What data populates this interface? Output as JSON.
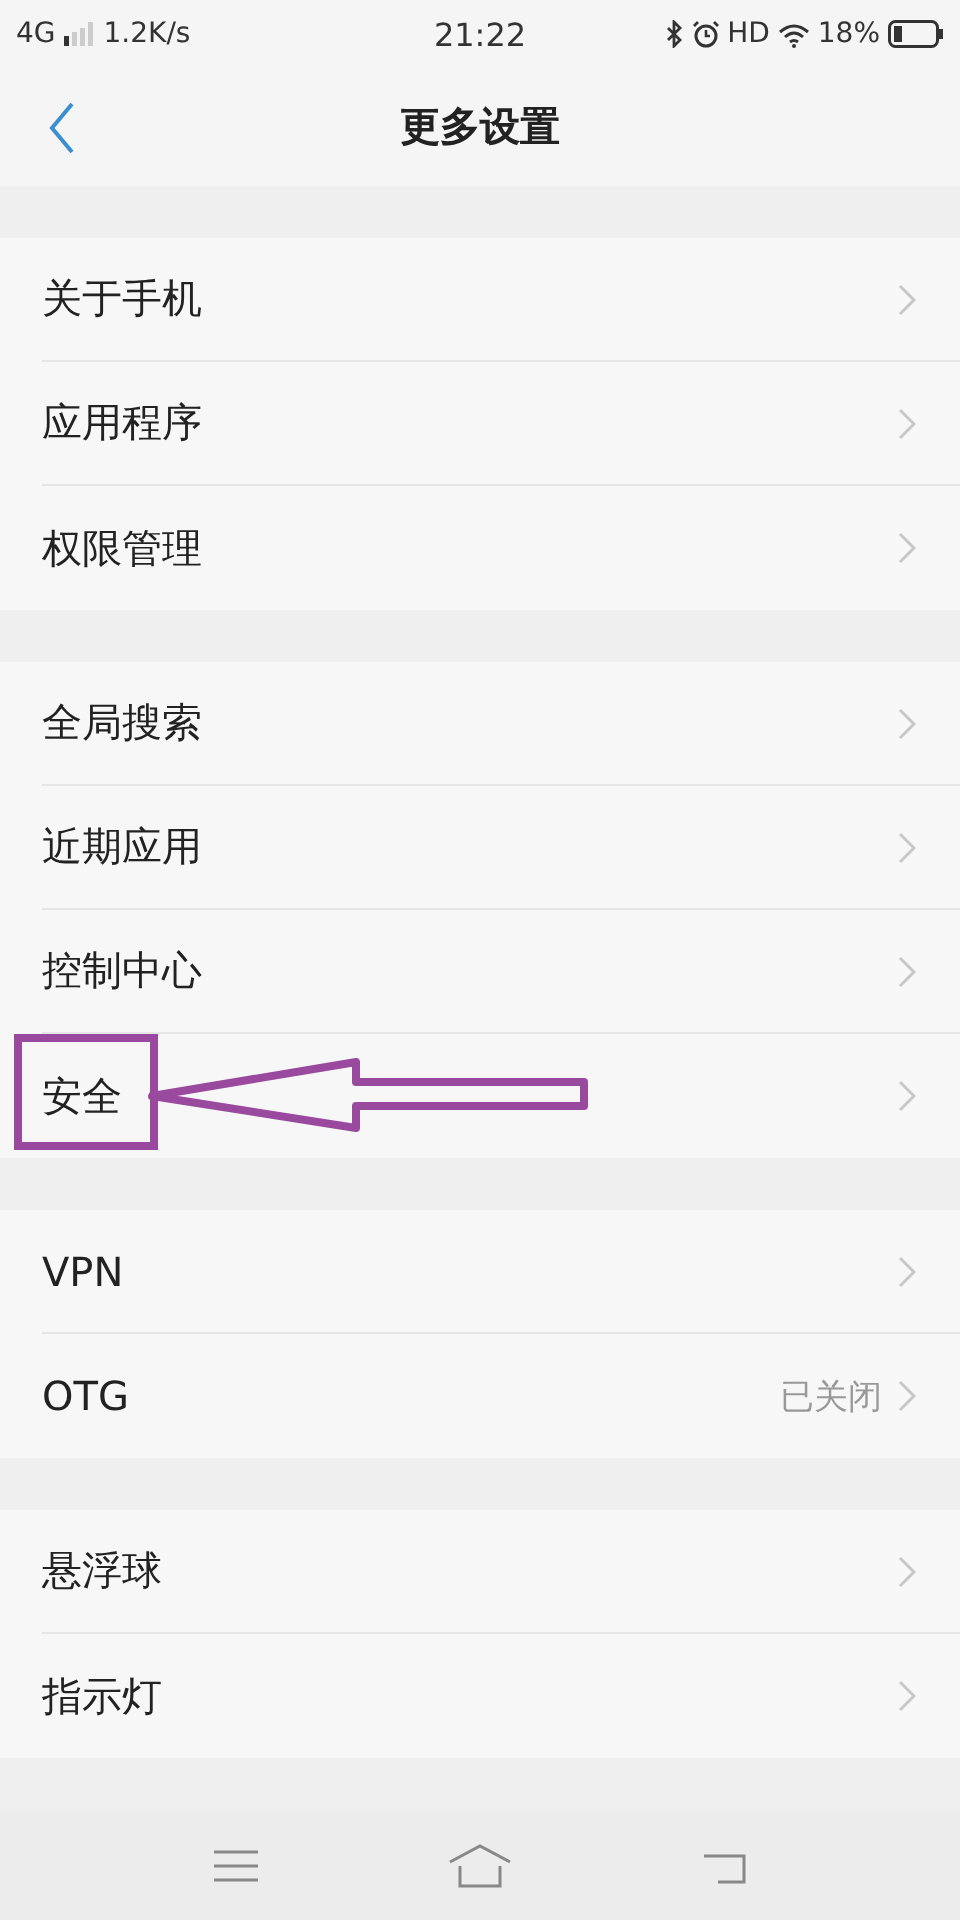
{
  "status_bar": {
    "network": "4G",
    "speed": "1.2K/s",
    "time": "21:22",
    "hd": "HD",
    "battery": "18%"
  },
  "header": {
    "title": "更多设置"
  },
  "groups": [
    {
      "items": [
        {
          "label": "关于手机",
          "highlighted": false
        },
        {
          "label": "应用程序",
          "highlighted": false
        },
        {
          "label": "权限管理",
          "highlighted": false
        }
      ]
    },
    {
      "items": [
        {
          "label": "全局搜索",
          "highlighted": false
        },
        {
          "label": "近期应用",
          "highlighted": false
        },
        {
          "label": "控制中心",
          "highlighted": false
        },
        {
          "label": "安全",
          "highlighted": true
        }
      ]
    },
    {
      "items": [
        {
          "label": "VPN",
          "highlighted": false
        },
        {
          "label": "OTG",
          "value": "已关闭",
          "highlighted": false
        }
      ]
    },
    {
      "items": [
        {
          "label": "悬浮球",
          "highlighted": false
        },
        {
          "label": "指示灯",
          "highlighted": false
        }
      ]
    }
  ]
}
